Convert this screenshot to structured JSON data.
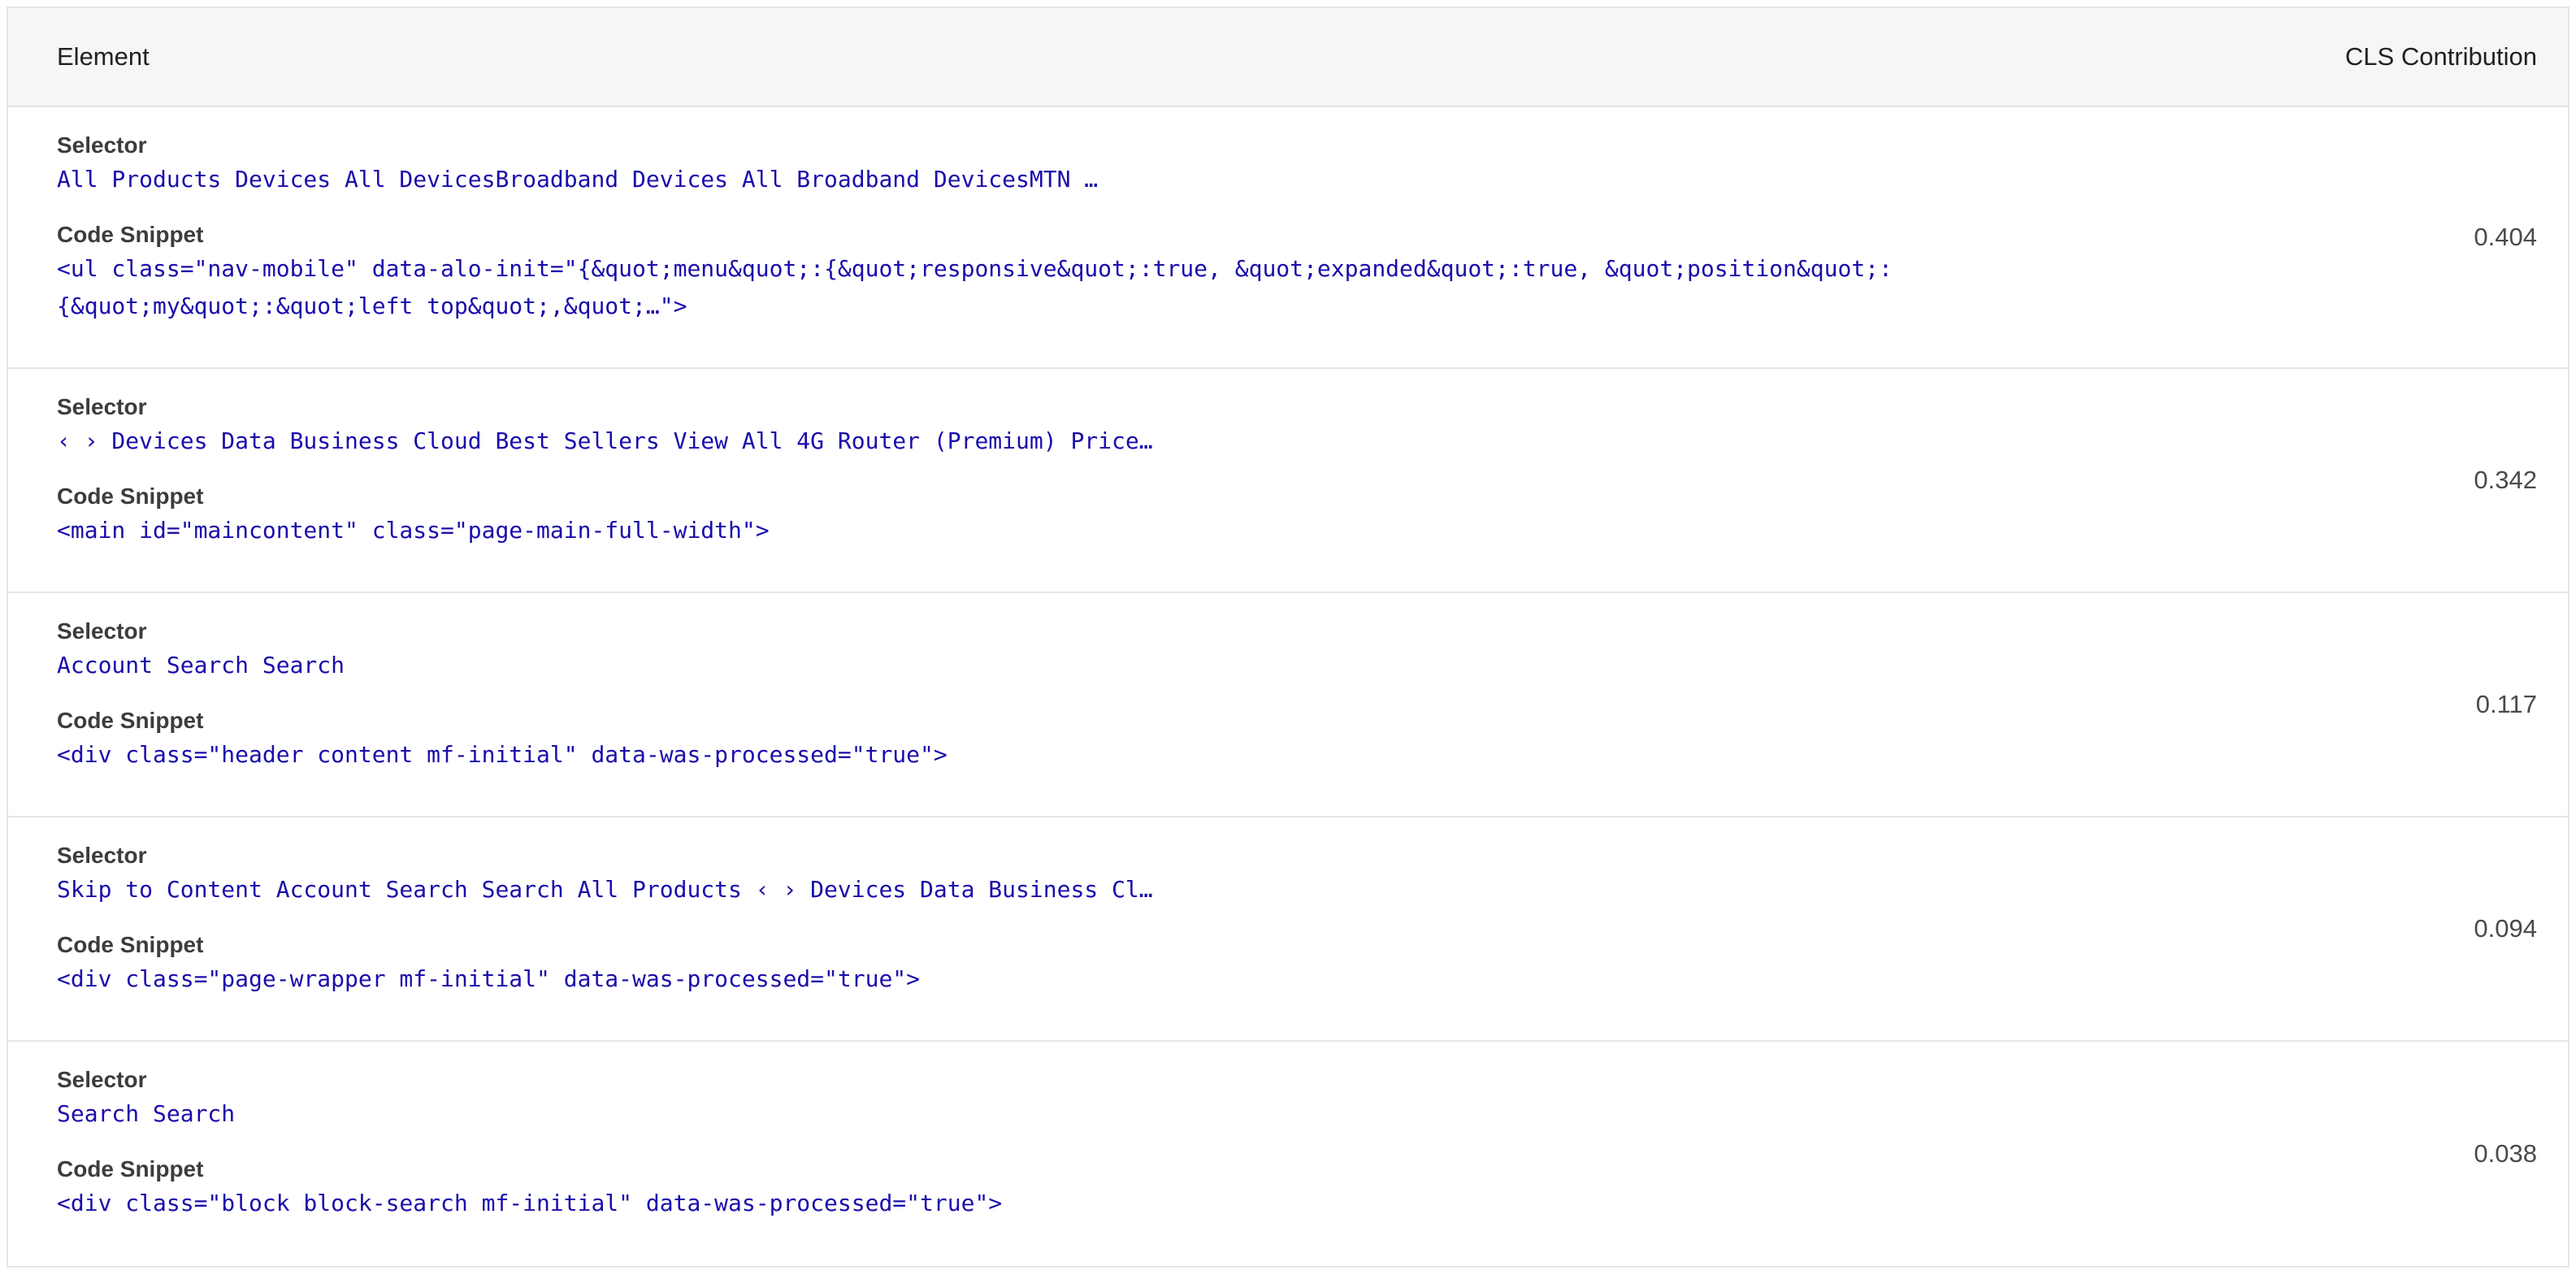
{
  "table": {
    "header": {
      "element": "Element",
      "cls": "CLS Contribution"
    },
    "labels": {
      "selector": "Selector",
      "snippet": "Code Snippet"
    },
    "rows": [
      {
        "selector": "All Products Devices All DevicesBroadband Devices All Broadband DevicesMTN …",
        "snippet": "<ul class=\"nav-mobile\" data-alo-init=\"{&quot;menu&quot;:{&quot;responsive&quot;:true, &quot;expanded&quot;:true, &quot;position&quot;:{&quot;my&quot;:&quot;left top&quot;,&quot;…\">",
        "cls": "0.404"
      },
      {
        "selector": "‹ › Devices Data Business Cloud Best Sellers View All 4G Router (Premium) Price…",
        "snippet": "<main id=\"maincontent\" class=\"page-main-full-width\">",
        "cls": "0.342"
      },
      {
        "selector": "Account Search Search",
        "snippet": "<div class=\"header content mf-initial\" data-was-processed=\"true\">",
        "cls": "0.117"
      },
      {
        "selector": "Skip to Content Account Search Search All Products ‹ › Devices Data Business Cl…",
        "snippet": "<div class=\"page-wrapper mf-initial\" data-was-processed=\"true\">",
        "cls": "0.094"
      },
      {
        "selector": "Search Search",
        "snippet": "<div class=\"block block-search mf-initial\" data-was-processed=\"true\">",
        "cls": "0.038"
      }
    ]
  }
}
